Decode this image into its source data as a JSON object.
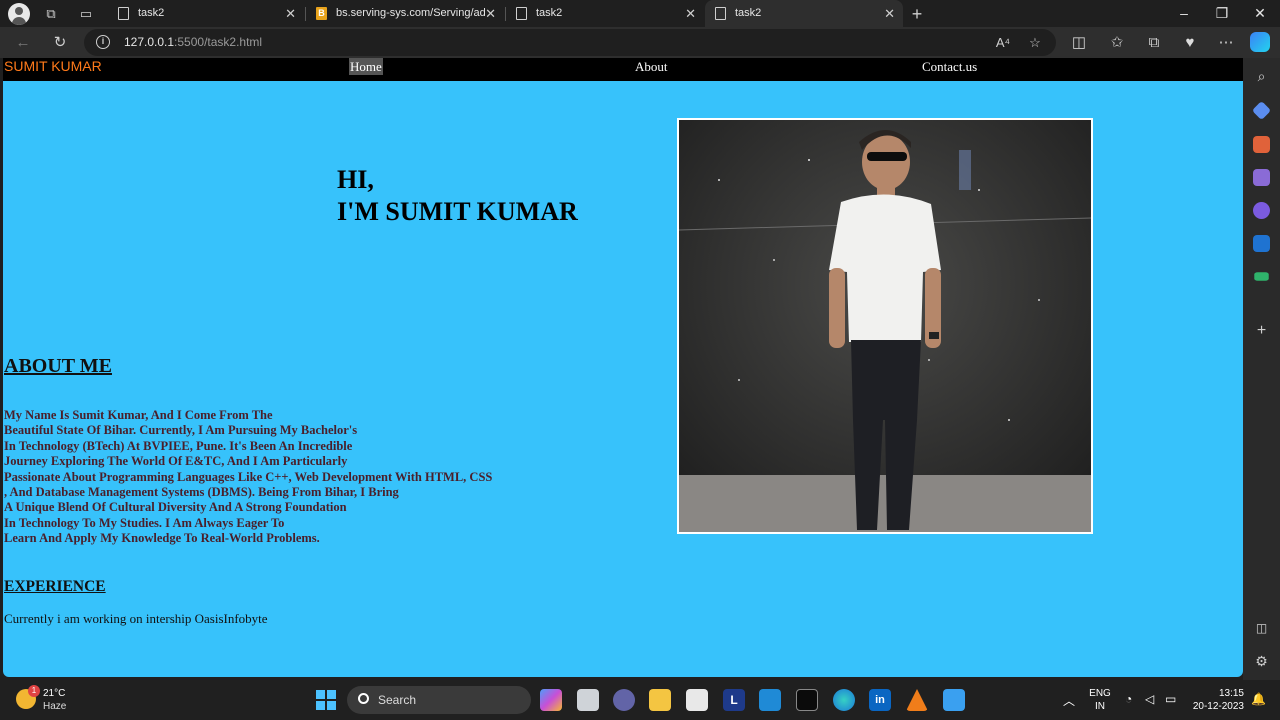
{
  "browser": {
    "tabs": [
      {
        "label": "task2",
        "active": false
      },
      {
        "label": "bs.serving-sys.com/Serving/adSe",
        "active": false
      },
      {
        "label": "task2",
        "active": false
      },
      {
        "label": "task2",
        "active": true
      }
    ],
    "new_tab": "+",
    "url_host": "127.0.0.1",
    "url_rest": ":5500/task2.html",
    "read_aloud": "A⁴"
  },
  "page": {
    "brand": "SUMIT KUMAR",
    "nav": [
      "Home",
      "About",
      "Contact.us"
    ],
    "hero_line1": "HI,",
    "hero_line2": "I'M SUMIT KUMAR",
    "about_heading": "ABOUT ME",
    "about_lines": [
      "My Name Is Sumit Kumar, And I Come From The",
      "Beautiful State Of Bihar. Currently, I Am Pursuing My Bachelor's",
      "In Technology (BTech) At BVPIEE, Pune. It's Been An Incredible",
      "Journey Exploring The World Of E&TC, And I Am Particularly",
      "Passionate About Programming Languages Like C++, Web Development With HTML, CSS",
      ", And Database Management Systems (DBMS). Being From Bihar, I Bring",
      "A Unique Blend Of Cultural Diversity And A Strong Foundation",
      "In Technology To My Studies. I Am Always Eager To",
      "Learn And Apply My Knowledge To Real-World Problems."
    ],
    "experience_heading": "EXPERIENCE",
    "experience_text": "Currently i am working on intership OasisInfobyte"
  },
  "taskbar": {
    "weather_temp": "21°C",
    "weather_desc": "Haze",
    "weather_badge": "1",
    "search_label": "Search",
    "lang_line1": "ENG",
    "lang_line2": "IN",
    "time": "13:15",
    "date": "20-12-2023"
  },
  "colors": {
    "page_bg": "#37c2fb",
    "navbar_bg": "#000000",
    "brand": "#ff7a1a"
  }
}
